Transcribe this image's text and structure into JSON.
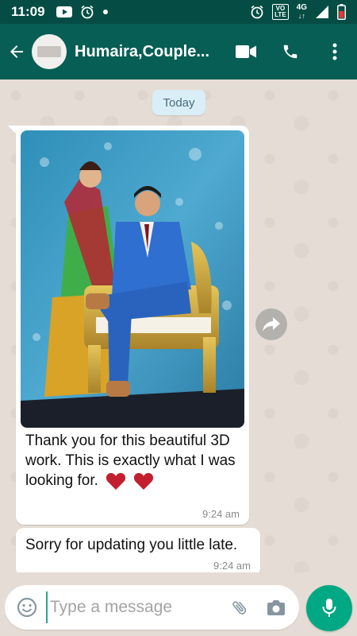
{
  "status_bar": {
    "time": "11:09",
    "volte_top": "VO",
    "volte_bottom": "LTE",
    "network": "4G",
    "icons": [
      "youtube-icon",
      "alarm-icon",
      "notification-dot-icon",
      "alarm-icon",
      "signal-icon",
      "battery-icon"
    ]
  },
  "header": {
    "title": "Humaira,Couple...",
    "icons": [
      "back-arrow-icon",
      "video-call-icon",
      "phone-call-icon",
      "more-options-icon"
    ]
  },
  "chat": {
    "date_chip": "Today",
    "messages": [
      {
        "type": "image",
        "text": "Thank you for this beautiful 3D work. This is exactly what I was looking for.",
        "emoji": "❤️❤️",
        "time": "9:24 am"
      },
      {
        "type": "text",
        "text": "Sorry for updating you little late.",
        "time": "9:24 am"
      }
    ],
    "forward_icon": "forward-icon"
  },
  "composer": {
    "placeholder": "Type a message",
    "value": "",
    "icons": [
      "emoji-icon",
      "attach-icon",
      "camera-icon",
      "mic-icon"
    ]
  },
  "colors": {
    "header": "#075e54",
    "status_bar": "#054d44",
    "accent": "#00a884",
    "chat_background": "#e5ddd5",
    "date_chip": "#d9eef7"
  }
}
